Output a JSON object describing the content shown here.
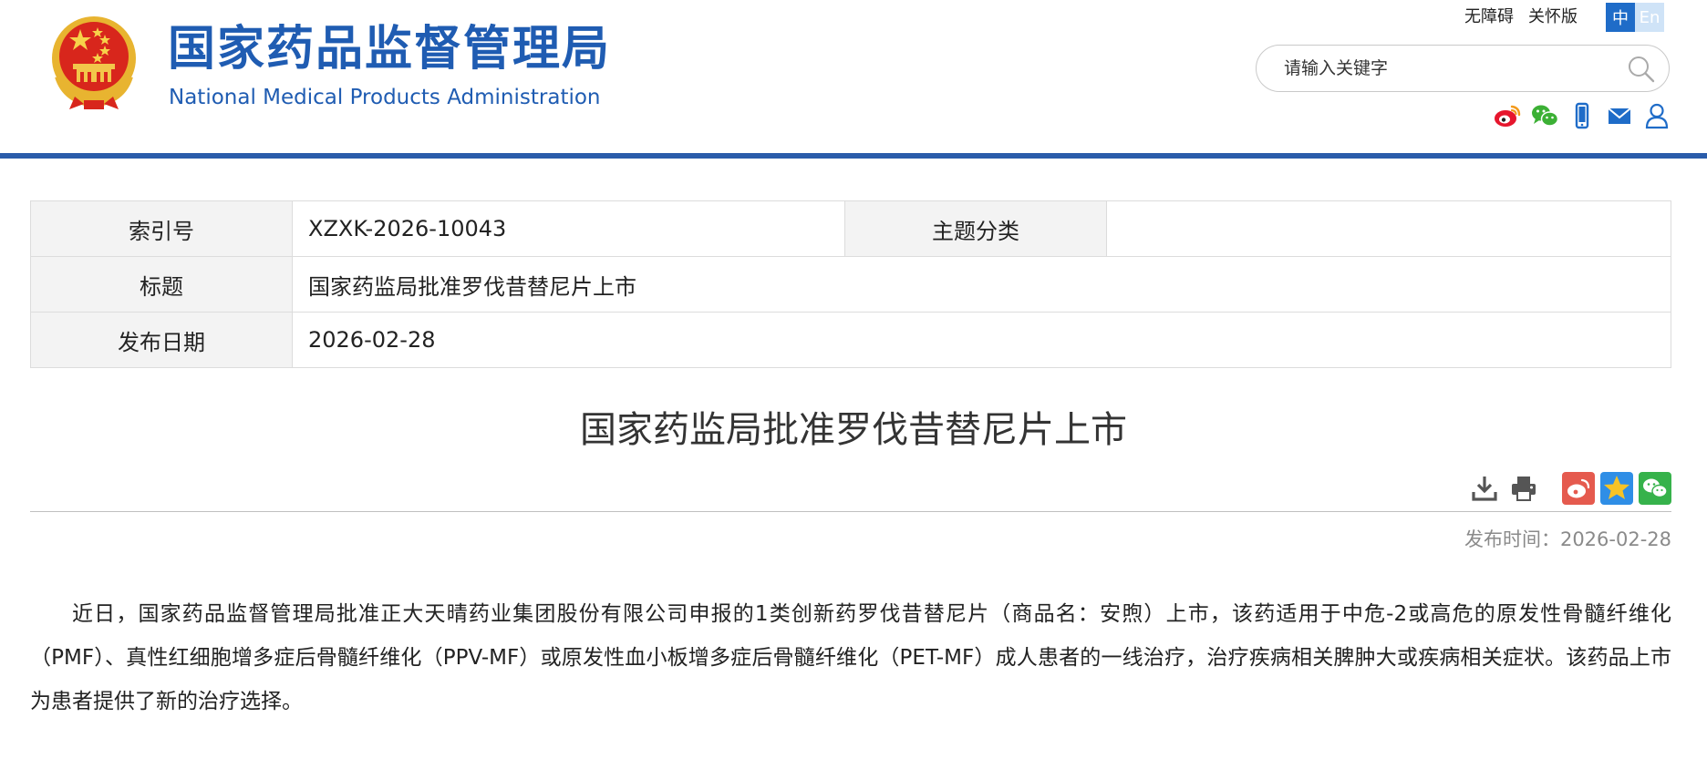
{
  "header": {
    "emblem_icon": "national-emblem-icon",
    "title_cn": "国家药品监督管理局",
    "title_en": "National Medical Products Administration",
    "brand_color": "#1f5cb2",
    "bar_color": "#2a5caa",
    "top_links": {
      "accessibility": "无障碍",
      "elder_mode": "关怀版"
    },
    "lang": {
      "cn": "中",
      "en": "En",
      "selected": "中"
    },
    "search": {
      "placeholder": "请输入关键字",
      "value": ""
    },
    "social_icons": [
      "weibo-icon",
      "wechat-icon",
      "mobile-icon",
      "mail-icon",
      "user-icon"
    ]
  },
  "info": {
    "index_label": "索引号",
    "index_value": "XZXK-2026-10043",
    "category_label": "主题分类",
    "category_value": "",
    "title_label": "标题",
    "title_value": "国家药监局批准罗伐昔替尼片上市",
    "date_label": "发布日期",
    "date_value": "2026-02-28"
  },
  "article": {
    "title": "国家药监局批准罗伐昔替尼片上市",
    "tools": [
      "download-icon",
      "print-icon",
      "weibo-share-icon",
      "qzone-share-icon",
      "wechat-share-icon"
    ],
    "publish_label": "发布时间：",
    "publish_date": "2026-02-28",
    "body": "近日，国家药品监督管理局批准正大天晴药业集团股份有限公司申报的1类创新药罗伐昔替尼片（商品名：安煦）上市，该药适用于中危-2或高危的原发性骨髓纤维化（PMF）、真性红细胞增多症后骨髓纤维化（PPV-MF）或原发性血小板增多症后骨髓纤维化（PET-MF）成人患者的一线治疗，治疗疾病相关脾肿大或疾病相关症状。该药品上市为患者提供了新的治疗选择。"
  }
}
